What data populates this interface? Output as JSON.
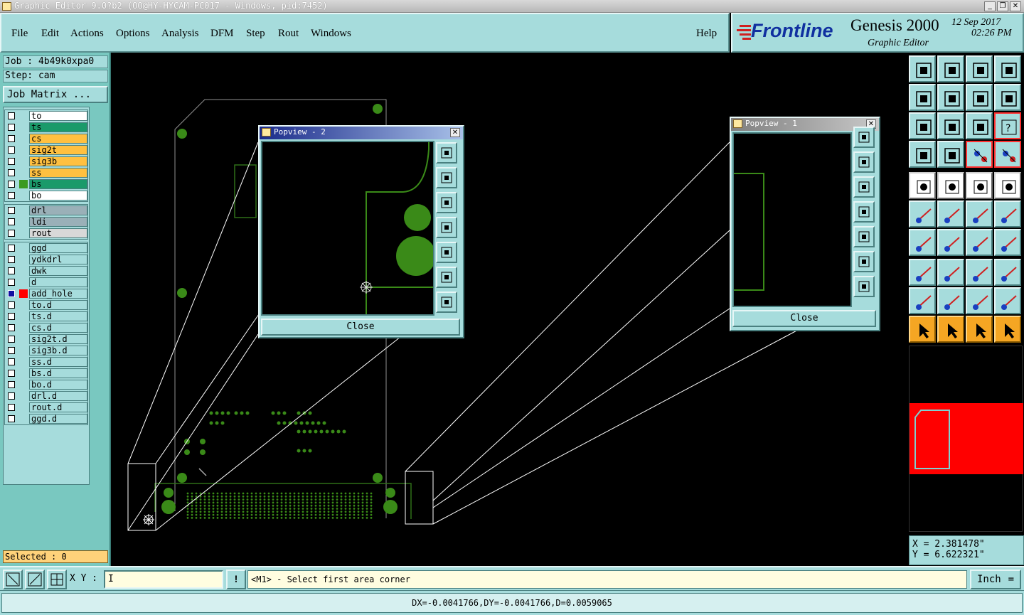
{
  "window": {
    "title": "Graphic Editor 9.0?b2 (OO@HY-HYCAM-PC017 - Windows, pid:7452)"
  },
  "menu": {
    "items": [
      "File",
      "Edit",
      "Actions",
      "Options",
      "Analysis",
      "DFM",
      "Step",
      "Rout",
      "Windows"
    ],
    "help": "Help"
  },
  "brand": {
    "logo": "Frontline",
    "product": "Genesis 2000",
    "subtitle": "Graphic Editor",
    "date": "12 Sep 2017",
    "time": "02:26 PM"
  },
  "job": {
    "job_label": "Job : 4b49k0xpa0",
    "step_label": "Step: cam",
    "matrix_button": "Job Matrix ..."
  },
  "layers": {
    "board": [
      {
        "name": "to",
        "bg": "#ffffff",
        "swatch": ""
      },
      {
        "name": "ts",
        "bg": "#1a9a6a",
        "swatch": ""
      },
      {
        "name": "cs",
        "bg": "#ffc040",
        "swatch": ""
      },
      {
        "name": "sig2t",
        "bg": "#ffc040",
        "swatch": ""
      },
      {
        "name": "sig3b",
        "bg": "#ffc040",
        "swatch": ""
      },
      {
        "name": "ss",
        "bg": "#ffc040",
        "swatch": ""
      },
      {
        "name": "bs",
        "bg": "#1a9a6a",
        "swatch": "#3a9a20"
      },
      {
        "name": "bo",
        "bg": "#ffffff",
        "swatch": ""
      }
    ],
    "drill": [
      {
        "name": "drl",
        "bg": "#9ab0b8",
        "swatch": ""
      },
      {
        "name": "ldi",
        "bg": "#9ab0b8",
        "swatch": ""
      },
      {
        "name": "rout",
        "bg": "#d8d8d8",
        "swatch": ""
      }
    ],
    "misc": [
      {
        "name": "ggd",
        "bg": "#a6dcdc",
        "swatch": ""
      },
      {
        "name": "ydkdrl",
        "bg": "#a6dcdc",
        "swatch": ""
      },
      {
        "name": "dwk",
        "bg": "#a6dcdc",
        "swatch": ""
      },
      {
        "name": "d",
        "bg": "#a6dcdc",
        "swatch": ""
      },
      {
        "name": "add_hole",
        "bg": "#a6dcdc",
        "swatch": "#ff0000"
      },
      {
        "name": "to.d",
        "bg": "#a6dcdc",
        "swatch": ""
      },
      {
        "name": "ts.d",
        "bg": "#a6dcdc",
        "swatch": ""
      },
      {
        "name": "cs.d",
        "bg": "#a6dcdc",
        "swatch": ""
      },
      {
        "name": "sig2t.d",
        "bg": "#a6dcdc",
        "swatch": ""
      },
      {
        "name": "sig3b.d",
        "bg": "#a6dcdc",
        "swatch": ""
      },
      {
        "name": "ss.d",
        "bg": "#a6dcdc",
        "swatch": ""
      },
      {
        "name": "bs.d",
        "bg": "#a6dcdc",
        "swatch": ""
      },
      {
        "name": "bo.d",
        "bg": "#a6dcdc",
        "swatch": ""
      },
      {
        "name": "drl.d",
        "bg": "#a6dcdc",
        "swatch": ""
      },
      {
        "name": "rout.d",
        "bg": "#a6dcdc",
        "swatch": ""
      },
      {
        "name": "ggd.d",
        "bg": "#a6dcdc",
        "swatch": ""
      }
    ]
  },
  "status": {
    "selected": "Selected : 0",
    "xy_label": "X Y :",
    "prompt": "<M1> - Select first area corner",
    "units": "Inch",
    "delta": "DX=-0.0041766,DY=-0.0041766,D=0.0059065"
  },
  "coords": {
    "x": "X = 2.381478\"",
    "y": "Y = 6.622321\""
  },
  "popview2": {
    "title": "Popview - 2",
    "close": "Close"
  },
  "popview1": {
    "title": "Popview - 1",
    "close": "Close"
  },
  "colors": {
    "panel": "#a6dcdc",
    "feature": "#3a8a18",
    "profile": "#a0a0a0"
  }
}
